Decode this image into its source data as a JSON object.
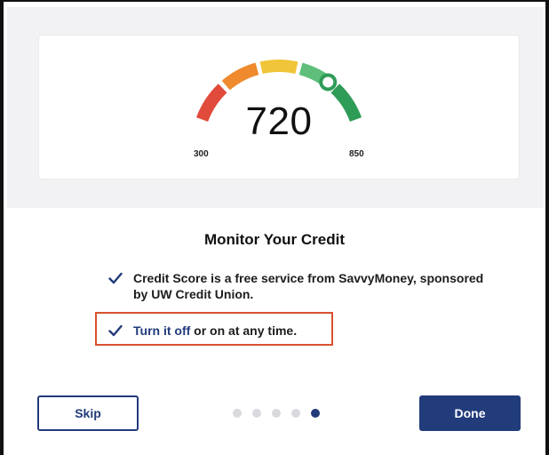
{
  "gauge": {
    "score": "720",
    "min_label": "300",
    "max_label": "850",
    "score_min": 300,
    "score_max": 850,
    "score_value": 720,
    "segment_colors": [
      "#e14b3b",
      "#ef8a2e",
      "#f0c53a",
      "#5fbf7a",
      "#2e9c57"
    ]
  },
  "onboarding": {
    "title": "Monitor Your Credit",
    "items": [
      {
        "text": "Credit Score is a free service from SavvyMoney, sponsored by UW Credit Union."
      },
      {
        "link": "Turn it off",
        "rest": " or on at any time."
      }
    ]
  },
  "pagination": {
    "total": 5,
    "current": 5
  },
  "buttons": {
    "skip": "Skip",
    "done": "Done"
  },
  "colors": {
    "primary": "#213b7b",
    "highlight": "#d8512f",
    "check": "#213b7b"
  },
  "icons": {
    "check": "checkmark-icon",
    "gauge_marker": "gauge-marker-icon"
  }
}
